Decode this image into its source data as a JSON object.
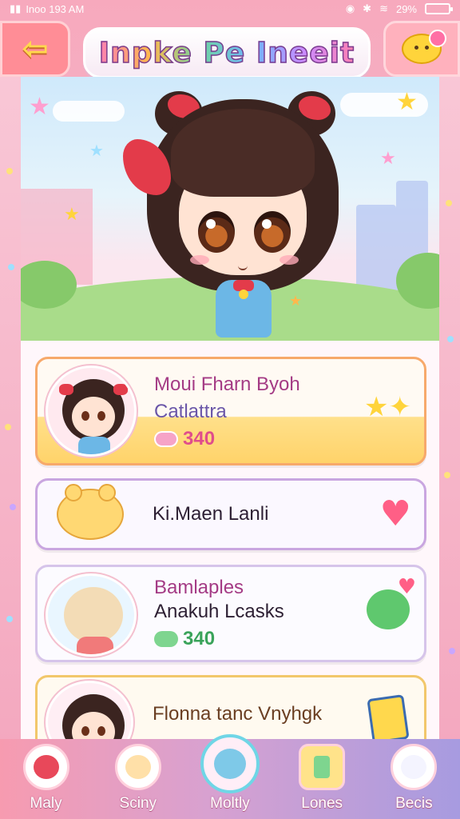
{
  "status": {
    "left_text": "Inoo 193 AM",
    "battery": "29%"
  },
  "header": {
    "title": "Inpke Pe Ineeit",
    "back_icon": "arrow-left-icon",
    "chat_icon": "chat-bubble-icon"
  },
  "cards": [
    {
      "name": "Moui Fharn Byoh",
      "subtitle": "Catlattra",
      "points": "340",
      "points_icon": "pink-cloud-icon",
      "right_icon": "sparkle-stars-icon"
    },
    {
      "name": "Ki.Maen Lanli",
      "right_icon": "heart-icon"
    },
    {
      "name": "Bamlaples",
      "subtitle": "Anakuh Lcasks",
      "points": "340",
      "points_icon": "green-cloud-icon",
      "right_icon": "speech-heart-icon"
    },
    {
      "name": "Flonna tanc Vnyhgk",
      "right_icon": "book-icon"
    }
  ],
  "nav": [
    {
      "label": "Maly",
      "icon": "girl-avatar-icon"
    },
    {
      "label": "Sciny",
      "icon": "bunny-icon"
    },
    {
      "label": "Moltly",
      "icon": "blue-face-icon",
      "active": true
    },
    {
      "label": "Lones",
      "icon": "chart-icon"
    },
    {
      "label": "Becis",
      "icon": "ghost-icon"
    }
  ],
  "colors": {
    "accent_pink": "#f7a9bd",
    "card1_border": "#f7a96b",
    "nav_gradient_end": "#a79be0",
    "active_ring": "#6fd6e6"
  }
}
